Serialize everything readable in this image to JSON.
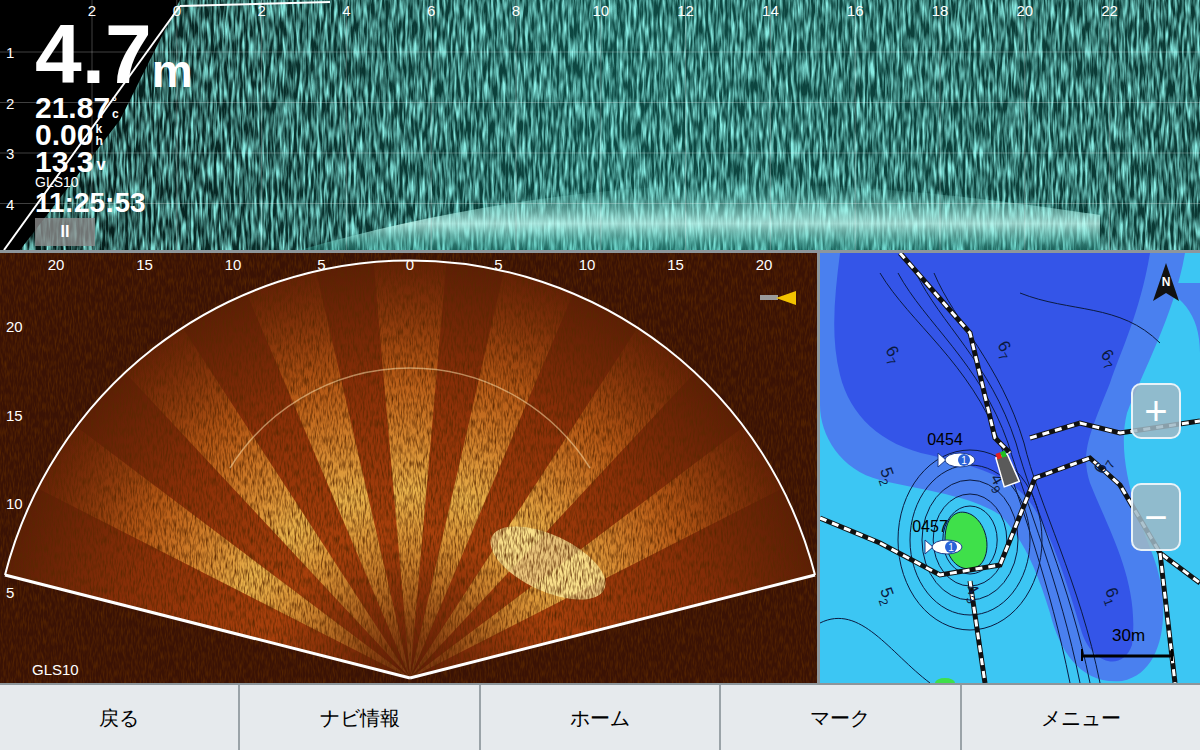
{
  "sonar_top": {
    "depth": "4.7",
    "depth_unit": "m",
    "temperature": "21.87",
    "temperature_unit": "°c",
    "speed": "0.00",
    "speed_unit": "kh",
    "voltage": "13.3",
    "voltage_unit": "v",
    "source": "GLS10",
    "time": "11:25:53",
    "pause_button": "II",
    "range_ticks": [
      "2",
      "0",
      "2",
      "4",
      "6",
      "8",
      "10",
      "12",
      "14",
      "16",
      "18",
      "20",
      "22"
    ],
    "depth_ticks": [
      "1",
      "2",
      "3",
      "4"
    ]
  },
  "sonar_fan": {
    "range_ticks": [
      "20",
      "15",
      "10",
      "5",
      "0",
      "5",
      "10",
      "15",
      "20"
    ],
    "depth_ticks": [
      "20",
      "15",
      "10",
      "5"
    ],
    "source": "GLS10"
  },
  "map": {
    "north": "N",
    "zoom_in": "+",
    "zoom_out": "−",
    "scale": "30m",
    "depth_labels": [
      {
        "whole": "6",
        "tenth": "7"
      },
      {
        "whole": "6",
        "tenth": "7"
      },
      {
        "whole": "6",
        "tenth": "7"
      },
      {
        "whole": "5",
        "tenth": "2"
      },
      {
        "whole": "4",
        "tenth": "9"
      },
      {
        "whole": "6",
        "tenth": "7"
      },
      {
        "whole": "5",
        "tenth": "2"
      },
      {
        "whole": "4",
        "tenth": "3"
      },
      {
        "whole": "6",
        "tenth": "1"
      }
    ],
    "waypoints": [
      {
        "name": "0454"
      },
      {
        "name": "0457"
      }
    ],
    "fish_markers": [
      {
        "label": "1"
      },
      {
        "label": "1"
      }
    ]
  },
  "softkeys": [
    {
      "label": "戻る"
    },
    {
      "label": "ナビ情報"
    },
    {
      "label": "ホーム"
    },
    {
      "label": "マーク"
    },
    {
      "label": "メニュー"
    }
  ]
}
